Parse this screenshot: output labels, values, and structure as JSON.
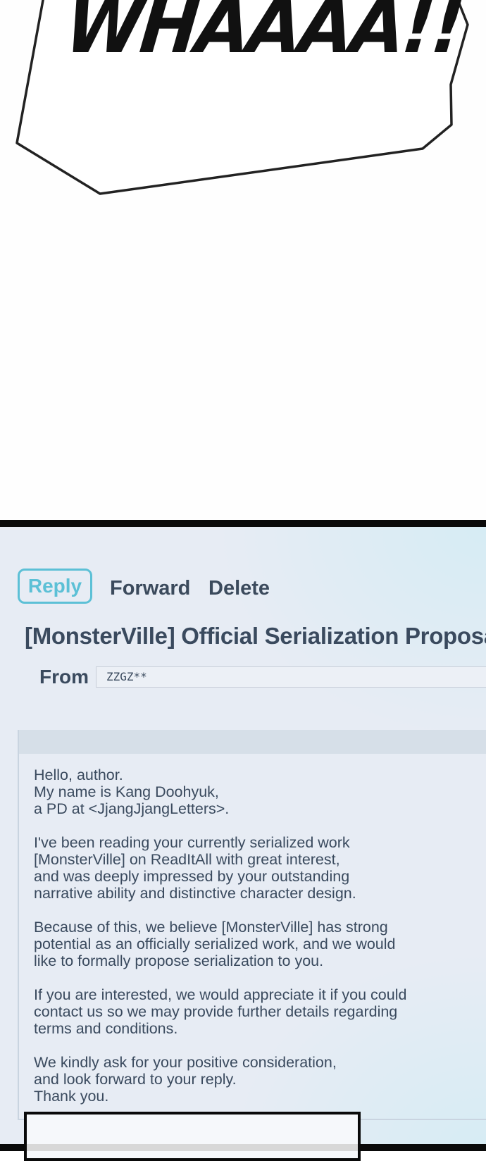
{
  "comic": {
    "shout_text": "WHAAAA!!"
  },
  "toolbar": {
    "reply_label": "Reply",
    "forward_label": "Forward",
    "delete_label": "Delete",
    "accent_color": "#5cc0d6"
  },
  "email": {
    "subject": "[MonsterVille] Official Serialization Proposal",
    "from_label": "From",
    "from_value": "ZZGZ**",
    "body": [
      [
        "Hello, author.",
        "My name is Kang Doohyuk,",
        "a PD at <JjangJjangLetters>."
      ],
      [
        "I've been reading your currently serialized work",
        "[MonsterVille] on ReadItAll with great interest,",
        "and was deeply impressed by your outstanding",
        "narrative ability and distinctive character design."
      ],
      [
        "Because of this, we believe [MonsterVille] has strong",
        "potential as an officially serialized work, and we would",
        "like to formally propose serialization to you."
      ],
      [
        "If you are interested, we would appreciate it if you could",
        "contact us so we may provide further details regarding",
        "terms and conditions."
      ],
      [
        "We kindly ask for your positive consideration,",
        "and look forward to your reply.",
        "Thank you."
      ]
    ]
  }
}
